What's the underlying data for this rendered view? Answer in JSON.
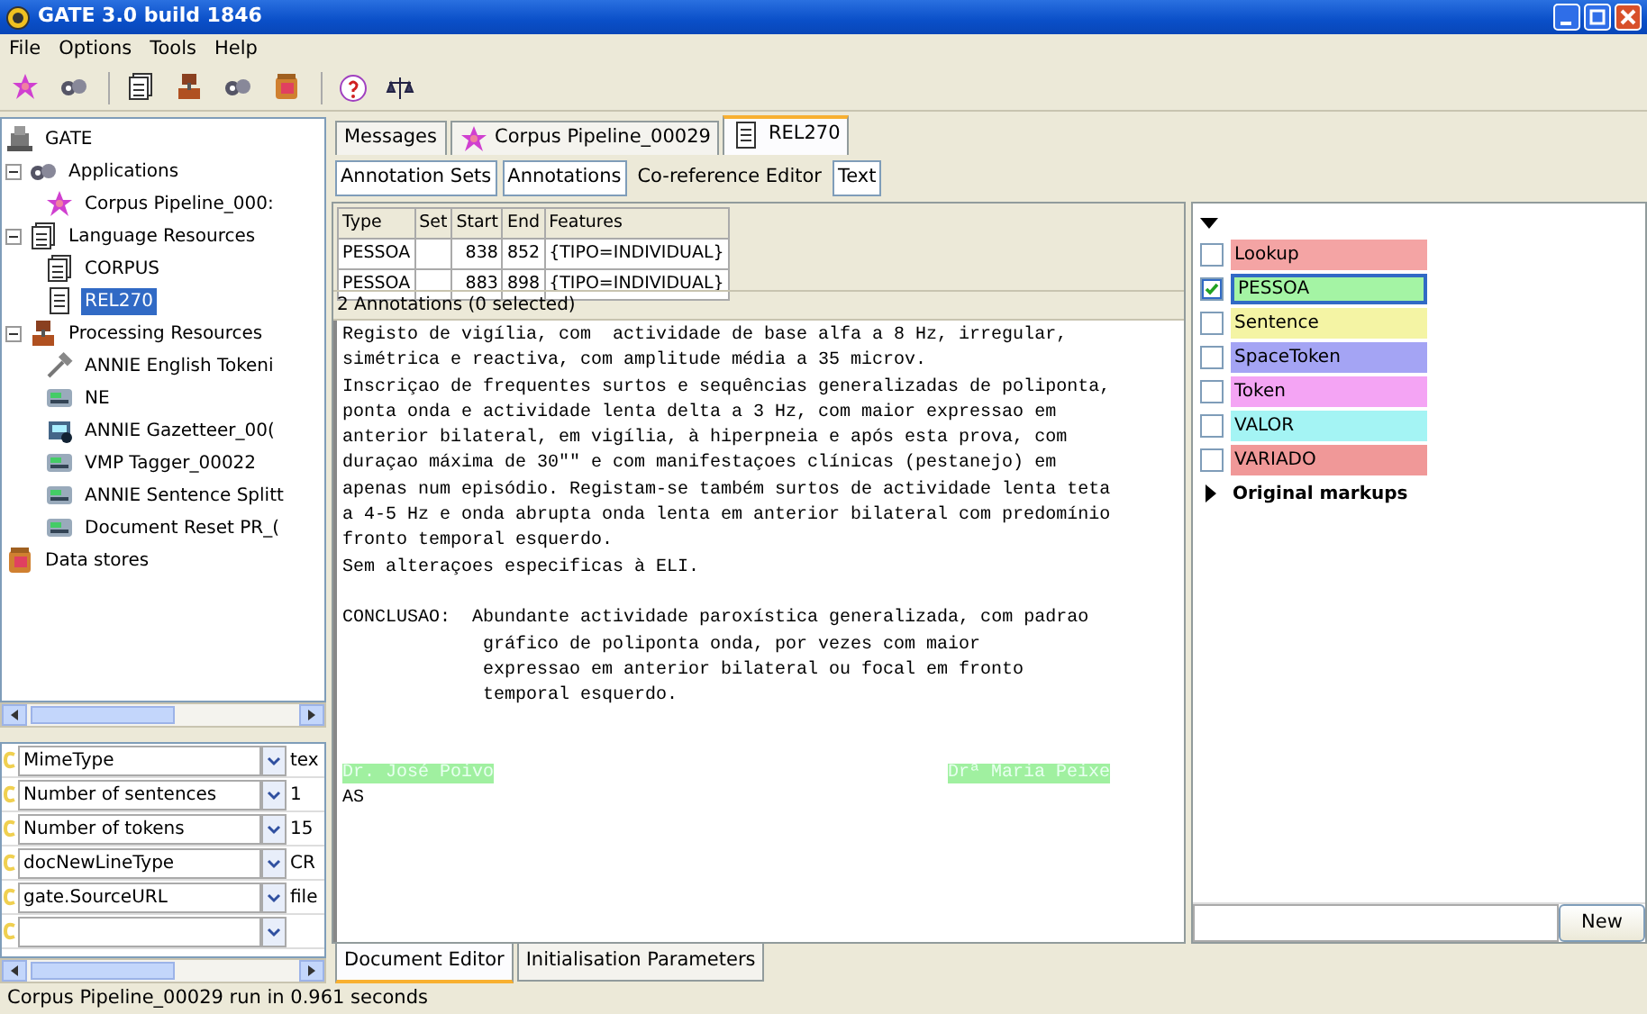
{
  "window": {
    "title": "GATE 3.0 build 1846"
  },
  "menu": [
    "File",
    "Options",
    "Tools",
    "Help"
  ],
  "tree": {
    "label": "GATE",
    "kind": "root",
    "children": [
      {
        "label": "Applications",
        "kind": "applications",
        "expanded": true,
        "selected": false,
        "children": [
          {
            "label": "Corpus Pipeline_000:",
            "kind": "pipeline",
            "selected": false
          }
        ]
      },
      {
        "label": "Language Resources",
        "kind": "corpus",
        "expanded": true,
        "selected": false,
        "children": [
          {
            "label": "CORPUS",
            "kind": "corpus",
            "selected": false
          },
          {
            "label": "REL270",
            "kind": "document",
            "selected": true
          }
        ]
      },
      {
        "label": "Processing Resources",
        "kind": "processing",
        "expanded": true,
        "selected": false,
        "children": [
          {
            "label": "ANNIE English Tokeni",
            "kind": "tokeniser",
            "selected": false
          },
          {
            "label": "NE",
            "kind": "module",
            "selected": false
          },
          {
            "label": "ANNIE Gazetteer_00(",
            "kind": "gazetteer",
            "selected": false
          },
          {
            "label": "VMP Tagger_00022",
            "kind": "module",
            "selected": false
          },
          {
            "label": "ANNIE Sentence Splitt",
            "kind": "module",
            "selected": false
          },
          {
            "label": "Document Reset PR_(",
            "kind": "module",
            "selected": false
          }
        ]
      },
      {
        "label": "Data stores",
        "kind": "datastore",
        "selected": false
      }
    ]
  },
  "features": [
    {
      "name": "MimeType",
      "value": "tex"
    },
    {
      "name": "Number of sentences",
      "value": "1"
    },
    {
      "name": "Number of tokens",
      "value": "15"
    },
    {
      "name": "docNewLineType",
      "value": "CR"
    },
    {
      "name": "gate.SourceURL",
      "value": "file"
    },
    {
      "kind": "empty"
    }
  ],
  "tabs": [
    {
      "label": "Messages",
      "selected": false
    },
    {
      "label": "Corpus Pipeline_00029",
      "kind": "pipeline",
      "selected": false
    },
    {
      "label": "REL270",
      "kind": "document",
      "selected": true
    }
  ],
  "view_buttons": [
    {
      "label": "Annotation Sets",
      "on": true
    },
    {
      "label": "Annotations",
      "on": true
    },
    {
      "label": "Co-reference Editor",
      "on": false
    },
    {
      "label": "Text",
      "on": true
    }
  ],
  "annotations": {
    "columns": [
      "Type",
      "Set",
      "Start",
      "End",
      "Features"
    ],
    "rows": [
      [
        "PESSOA",
        "",
        "838",
        "852",
        "{TIPO=INDIVIDUAL}"
      ],
      [
        "PESSOA",
        "",
        "883",
        "898",
        "{TIPO=INDIVIDUAL}"
      ]
    ],
    "summary": "2 Annotations (0 selected)"
  },
  "document": [
    {
      "text": "Registo de vigília, com  actividade de base alfa a 8 Hz, irregular,"
    },
    {
      "text": "simétrica e reactiva, com amplitude média a 35 microv."
    },
    {
      "text": "Inscriçao de frequentes surtos e sequências generalizadas de poliponta,"
    },
    {
      "text": "ponta onda e actividade lenta delta a 3 Hz, com maior expressao em"
    },
    {
      "text": "anterior bilateral, em vigília, à hiperpneia e após esta prova, com"
    },
    {
      "text": "duraçao máxima de 30\"\" e com manifestaçoes clínicas (pestanejo) em"
    },
    {
      "text": "apenas num episódio. Registam-se também surtos de actividade lenta teta"
    },
    {
      "text": "a 4-5 Hz e onda abrupta onda lenta em anterior bilateral com predomínio"
    },
    {
      "text": "fronto temporal esquerdo."
    },
    {
      "text": "Sem alteraçoes especificas à ELI."
    },
    {
      "kind": "labelled",
      "label": "CONCLUSAO:",
      "text": "Abundante actividade paroxística generalizada, com padrao"
    },
    {
      "kind": "indented",
      "text": "gráfico de poliponta onda, por vezes com maior"
    },
    {
      "kind": "indented",
      "text": "expressao em anterior bilateral ou focal em fronto"
    },
    {
      "kind": "indented",
      "text": "temporal esquerdo."
    },
    {
      "kind": "highlights",
      "spans": [
        {
          "text": "Dr. José Poivo",
          "color": "#a0f0a0"
        },
        {
          "text": "Drª Maria Peixe",
          "color": "#a0f0a0"
        }
      ]
    },
    {
      "text": "AS"
    }
  ],
  "annotation_types": {
    "items": [
      {
        "label": "Lookup",
        "checked": false,
        "color": "#f4a4a4"
      },
      {
        "label": "PESSOA",
        "checked": true,
        "color": "#a4f4a4"
      },
      {
        "label": "Sentence",
        "checked": false,
        "color": "#f4f4a4"
      },
      {
        "label": "SpaceToken",
        "checked": false,
        "color": "#a4a4f4"
      },
      {
        "label": "Token",
        "checked": false,
        "color": "#f4a4f4"
      },
      {
        "label": "VALOR",
        "checked": false,
        "color": "#a4f4f4"
      },
      {
        "label": "VARIADO",
        "checked": false,
        "color": "#f09898"
      }
    ],
    "group": {
      "label": "Original markups",
      "expanded": false
    },
    "new_button": "New"
  },
  "bottom_tabs": [
    {
      "label": "Document Editor",
      "selected": true
    },
    {
      "label": "Initialisation Parameters",
      "selected": false
    }
  ],
  "status_bar": "Corpus Pipeline_00029 run in 0.961 seconds"
}
